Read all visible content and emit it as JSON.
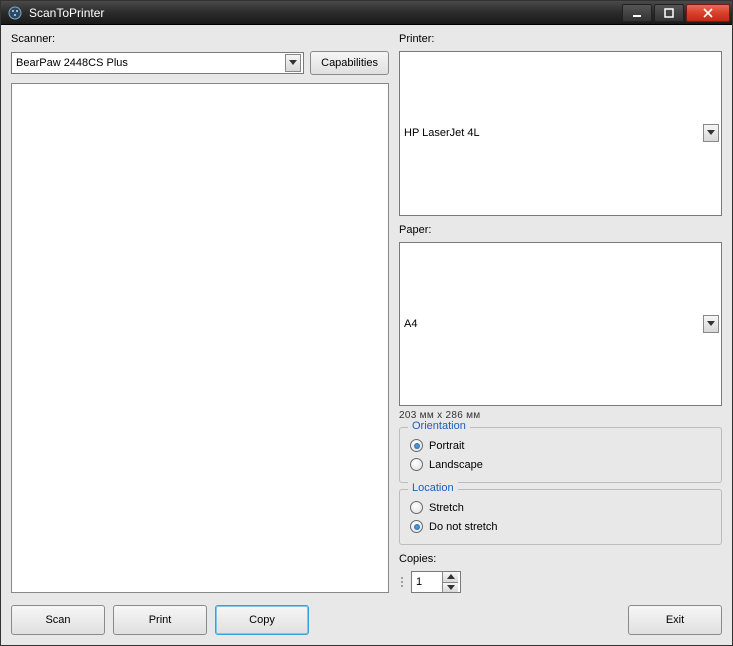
{
  "window": {
    "title": "ScanToPrinter"
  },
  "scanner": {
    "label": "Scanner:",
    "selected": "BearPaw 2448CS Plus",
    "capabilities_button": "Capabilities"
  },
  "printer": {
    "label": "Printer:",
    "selected": "HP LaserJet 4L"
  },
  "paper": {
    "label": "Paper:",
    "selected": "A4",
    "dimensions": "203 мм x 286 мм"
  },
  "orientation": {
    "legend": "Orientation",
    "options": {
      "portrait": {
        "label": "Portrait",
        "checked": true
      },
      "landscape": {
        "label": "Landscape",
        "checked": false
      }
    }
  },
  "location": {
    "legend": "Location",
    "options": {
      "stretch": {
        "label": "Stretch",
        "checked": false
      },
      "no_stretch": {
        "label": "Do not stretch",
        "checked": true
      }
    }
  },
  "copies": {
    "label": "Copies:",
    "value": "1"
  },
  "buttons": {
    "scan": "Scan",
    "print": "Print",
    "copy": "Copy",
    "exit": "Exit"
  }
}
